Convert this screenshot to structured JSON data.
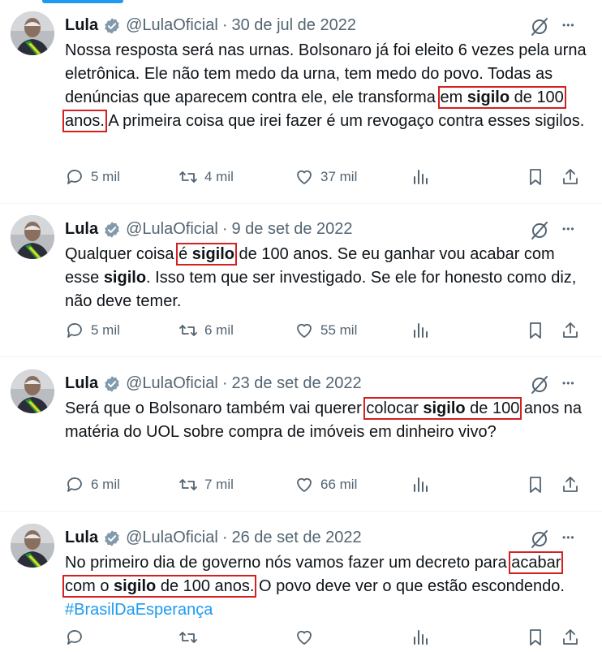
{
  "colors": {
    "accent": "#1d9bf0",
    "highlight": "#d42020",
    "muted": "#536471",
    "text": "#0f1419"
  },
  "tweets": [
    {
      "name": "Lula",
      "handle": "@LulaOficial",
      "separator": "·",
      "date": "30 de jul de 2022",
      "segments": [
        {
          "t": "Nossa resposta será nas urnas. Bolsonaro já foi eleito 6 vezes pela urna eletrônica. Ele não tem medo da urna, tem medo do povo. Todas as denúncias que aparecem contra ele, ele transforma "
        },
        {
          "t": "em ",
          "hl": "start"
        },
        {
          "t": "sigilo",
          "b": true,
          "hl": "mid"
        },
        {
          "t": " de 100 anos.",
          "hl": "end"
        },
        {
          "t": " A primeira coisa que irei fazer é um revogaço contra esses sigilos."
        }
      ],
      "replies": "5 mil",
      "retweets": "4 mil",
      "likes": "37 mil"
    },
    {
      "name": "Lula",
      "handle": "@LulaOficial",
      "separator": "·",
      "date": "9 de set de 2022",
      "segments": [
        {
          "t": "Qualquer coisa "
        },
        {
          "t": "é ",
          "hl": "start"
        },
        {
          "t": "sigilo",
          "b": true,
          "hl": "end"
        },
        {
          "t": " de 100 anos. Se eu ganhar vou acabar com esse "
        },
        {
          "t": "sigilo",
          "b": true
        },
        {
          "t": ". Isso tem que ser investigado. Se ele for honesto como diz, não deve temer."
        }
      ],
      "replies": "5 mil",
      "retweets": "6 mil",
      "likes": "55 mil"
    },
    {
      "name": "Lula",
      "handle": "@LulaOficial",
      "separator": "·",
      "date": "23 de set de 2022",
      "segments": [
        {
          "t": "Será que o Bolsonaro também vai querer "
        },
        {
          "t": "colocar ",
          "hl": "start"
        },
        {
          "t": "sigilo",
          "b": true,
          "hl": "mid"
        },
        {
          "t": " de 100",
          "hl": "end"
        },
        {
          "t": " anos na matéria do UOL sobre compra de imóveis em dinheiro vivo?"
        }
      ],
      "replies": "6 mil",
      "retweets": "7 mil",
      "likes": "66 mil"
    },
    {
      "name": "Lula",
      "handle": "@LulaOficial",
      "separator": "·",
      "date": "26 de set de 2022",
      "segments": [
        {
          "t": "No primeiro dia de governo nós vamos fazer um decreto para "
        },
        {
          "t": "acabar com o ",
          "hl": "start"
        },
        {
          "t": "sigilo",
          "b": true,
          "hl": "mid"
        },
        {
          "t": " de 100 anos.",
          "hl": "end"
        },
        {
          "t": " O povo deve ver o que estão escondendo. "
        },
        {
          "t": "#BrasilDaEsperança",
          "tag": true
        }
      ],
      "replies": "",
      "retweets": "",
      "likes": ""
    }
  ]
}
